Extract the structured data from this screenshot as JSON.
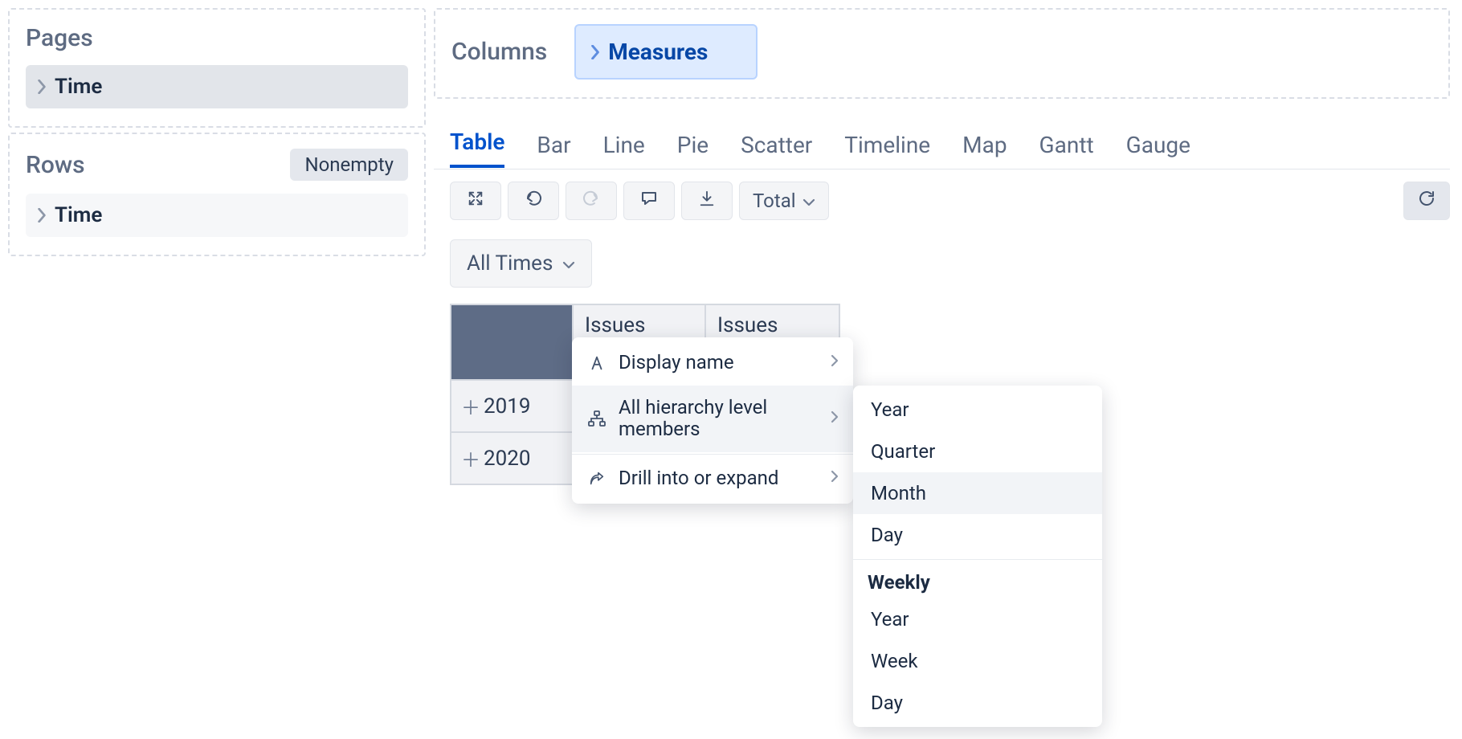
{
  "panels": {
    "pages": {
      "title": "Pages",
      "chip": "Time"
    },
    "rows": {
      "title": "Rows",
      "nonempty": "Nonempty",
      "chip": "Time"
    },
    "columns": {
      "title": "Columns",
      "chip": "Measures"
    }
  },
  "tabs": [
    "Table",
    "Bar",
    "Line",
    "Pie",
    "Scatter",
    "Timeline",
    "Map",
    "Gantt",
    "Gauge"
  ],
  "active_tab_index": 0,
  "toolbar": {
    "total_label": "Total"
  },
  "alltimes": "All Times",
  "table": {
    "col_headers": [
      "Issues",
      "Issues"
    ],
    "row_headers": [
      "2019",
      "2020"
    ]
  },
  "ctxmenu": {
    "items": [
      {
        "label": "Display name",
        "has_sub": true,
        "hover": false
      },
      {
        "label": "All hierarchy level members",
        "has_sub": true,
        "hover": true
      },
      {
        "label": "Drill into or expand",
        "has_sub": true,
        "hover": false
      }
    ]
  },
  "submenu": {
    "items": [
      "Year",
      "Quarter",
      "Month",
      "Day"
    ],
    "hover_index": 2,
    "section_title": "Weekly",
    "section_items": [
      "Year",
      "Week",
      "Day"
    ]
  },
  "chart_data": {
    "type": "table",
    "columns": [
      "Issues",
      "Issues"
    ],
    "rows": [
      "2019",
      "2020"
    ]
  }
}
